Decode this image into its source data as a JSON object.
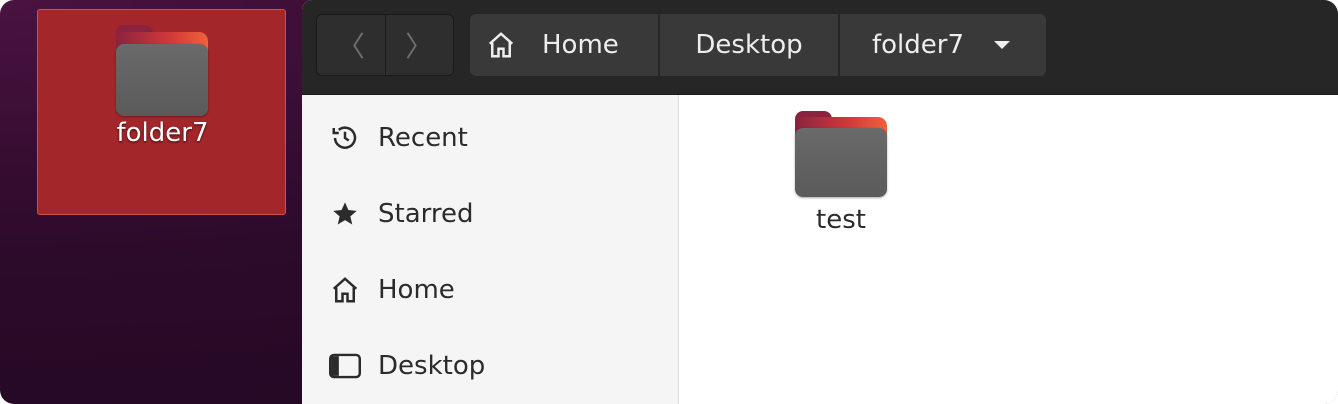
{
  "desktop": {
    "icon_label": "folder7"
  },
  "window": {
    "nav": {
      "back": "〈",
      "forward": "〉"
    },
    "pathbar": {
      "crumbs": [
        "Home",
        "Desktop",
        "folder7"
      ]
    },
    "sidebar": {
      "items": [
        {
          "label": "Recent",
          "icon": "clock-icon"
        },
        {
          "label": "Starred",
          "icon": "star-icon"
        },
        {
          "label": "Home",
          "icon": "home-icon"
        },
        {
          "label": "Desktop",
          "icon": "desktop-icon"
        }
      ]
    },
    "content": {
      "items": [
        {
          "label": "test",
          "icon": "folder-icon"
        }
      ]
    }
  },
  "colors": {
    "selection": "#a2262a",
    "headerbar": "#262626",
    "folder_accent": "#e5473a"
  }
}
